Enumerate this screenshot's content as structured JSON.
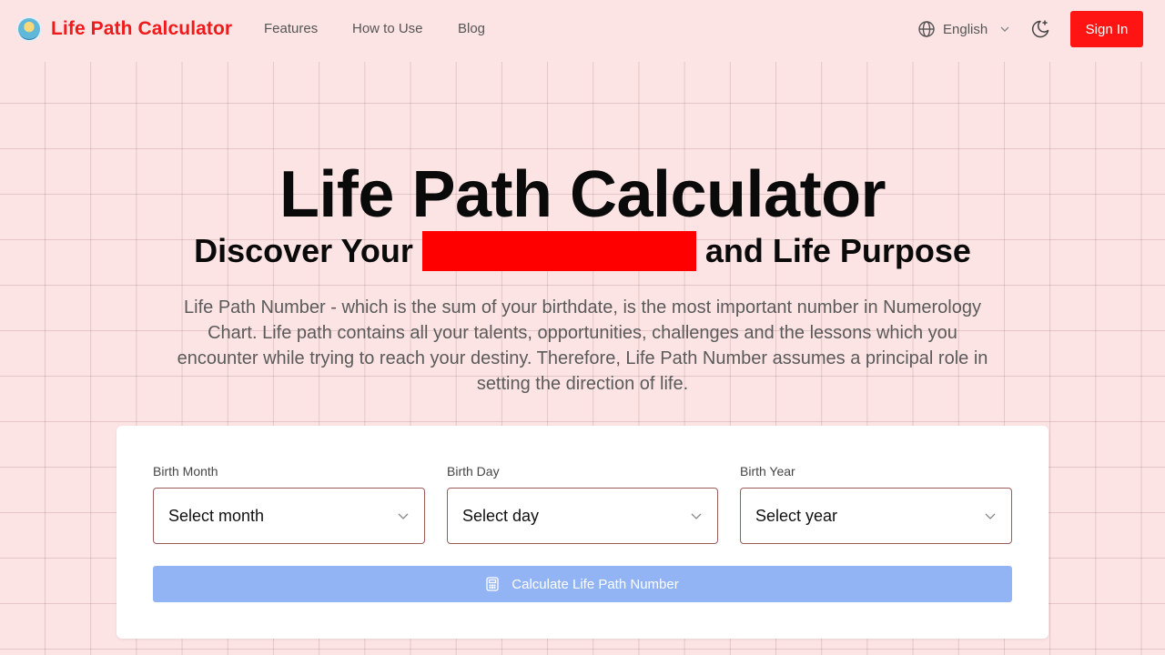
{
  "header": {
    "brand": "Life Path Calculator",
    "nav": [
      "Features",
      "How to Use",
      "Blog"
    ],
    "language": "English",
    "sign_in": "Sign In"
  },
  "hero": {
    "title": "Life Path Calculator",
    "subtitle_before": "Discover Your",
    "subtitle_after": "and Life Purpose",
    "description": "Life Path Number - which is the sum of your birthdate, is the most important number in Numerology Chart. Life path contains all your talents, opportunities, challenges and the lessons which you encounter while trying to reach your destiny. Therefore, Life Path Number assumes a principal role in setting the direction of life."
  },
  "form": {
    "month_label": "Birth Month",
    "month_value": "Select month",
    "day_label": "Birth Day",
    "day_value": "Select day",
    "year_label": "Birth Year",
    "year_value": "Select year",
    "calculate": "Calculate Life Path Number"
  },
  "colors": {
    "background": "#fde4e4",
    "brand": "#ef1a1a",
    "sign_in": "#ff1414",
    "highlight": "#ff0000",
    "calculate_button": "#93b4f4"
  },
  "icons": {
    "logo": "logo-icon",
    "language": "globe-icon",
    "language_dropdown": "chevron-down-icon",
    "theme": "moon-sparkle-icon",
    "select": "chevron-down-icon",
    "calculate": "calculator-icon"
  }
}
